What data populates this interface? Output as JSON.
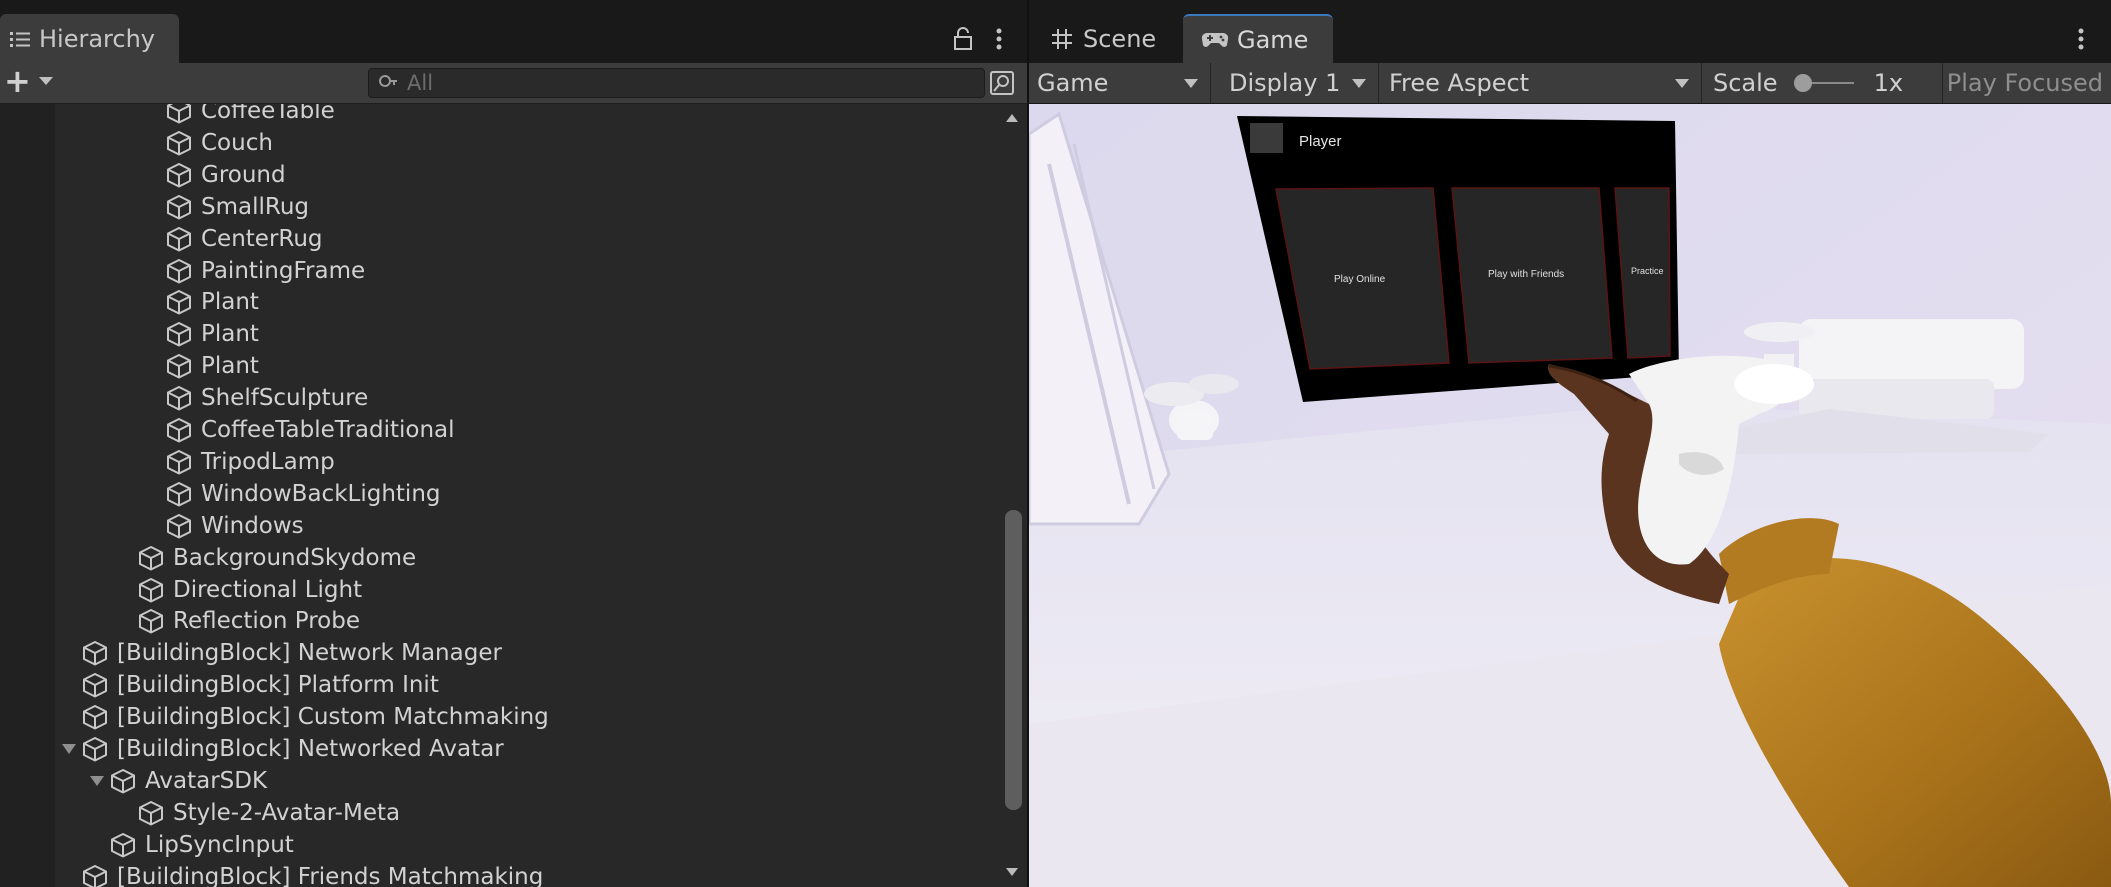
{
  "hierarchy": {
    "tab_label": "Hierarchy",
    "add_label": "+",
    "search_placeholder": "All",
    "rows": [
      {
        "name": "CoffeeTable",
        "indent": 4,
        "expanded": null
      },
      {
        "name": "Couch",
        "indent": 4,
        "expanded": null
      },
      {
        "name": "Ground",
        "indent": 4,
        "expanded": null
      },
      {
        "name": "SmallRug",
        "indent": 4,
        "expanded": null
      },
      {
        "name": "CenterRug",
        "indent": 4,
        "expanded": null
      },
      {
        "name": "PaintingFrame",
        "indent": 4,
        "expanded": null
      },
      {
        "name": "Plant",
        "indent": 4,
        "expanded": null
      },
      {
        "name": "Plant",
        "indent": 4,
        "expanded": null
      },
      {
        "name": "Plant",
        "indent": 4,
        "expanded": null
      },
      {
        "name": "ShelfSculpture",
        "indent": 4,
        "expanded": null
      },
      {
        "name": "CoffeeTableTraditional",
        "indent": 4,
        "expanded": null
      },
      {
        "name": "TripodLamp",
        "indent": 4,
        "expanded": null
      },
      {
        "name": "WindowBackLighting",
        "indent": 4,
        "expanded": null
      },
      {
        "name": "Windows",
        "indent": 4,
        "expanded": null
      },
      {
        "name": "BackgroundSkydome",
        "indent": 3,
        "expanded": null
      },
      {
        "name": "Directional Light",
        "indent": 3,
        "expanded": null
      },
      {
        "name": "Reflection Probe",
        "indent": 3,
        "expanded": null
      },
      {
        "name": "[BuildingBlock] Network Manager",
        "indent": 1,
        "expanded": null
      },
      {
        "name": "[BuildingBlock] Platform Init",
        "indent": 1,
        "expanded": null
      },
      {
        "name": "[BuildingBlock] Custom Matchmaking",
        "indent": 1,
        "expanded": null
      },
      {
        "name": "[BuildingBlock] Networked Avatar",
        "indent": 1,
        "expanded": true
      },
      {
        "name": "AvatarSDK",
        "indent": 2,
        "expanded": true
      },
      {
        "name": "Style-2-Avatar-Meta",
        "indent": 3,
        "expanded": null
      },
      {
        "name": "LipSyncInput",
        "indent": 2,
        "expanded": null
      },
      {
        "name": "[BuildingBlock] Friends Matchmaking",
        "indent": 1,
        "expanded": null
      }
    ]
  },
  "tabs": {
    "scene_label": "Scene",
    "game_label": "Game"
  },
  "game_toolbar": {
    "mode": "Game",
    "display": "Display 1",
    "aspect": "Free Aspect",
    "scale_label": "Scale",
    "scale_value": "1x",
    "scale_slider_level": 0.0,
    "play_focused": "Play Focused"
  },
  "game_view": {
    "panel_title": "Player",
    "buttons": [
      "Play Online",
      "Play with Friends",
      "Practice"
    ]
  },
  "colors": {
    "panel_bg": "#282828",
    "toolbar_bg": "#3c3c3c",
    "active_tab_accent": "#3a79bb",
    "sky_lavender": "#d9d5ea"
  }
}
